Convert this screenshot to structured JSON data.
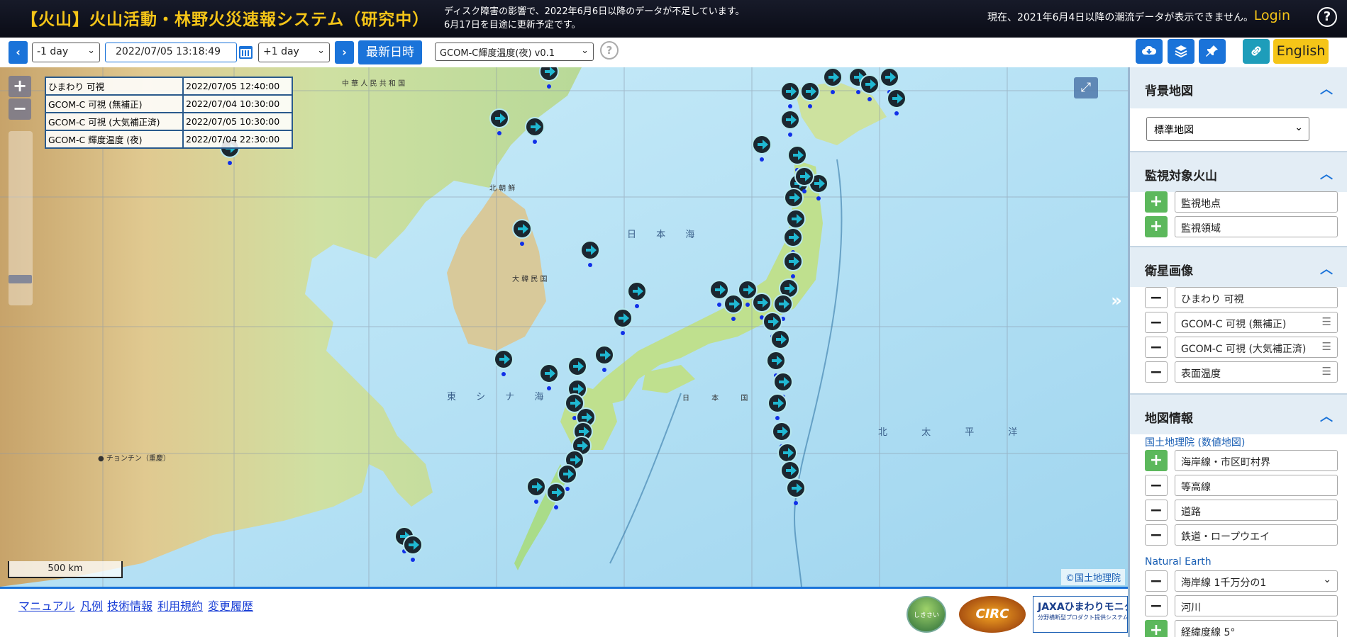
{
  "header": {
    "title": "【火山】火山活動・林野火災速報システム（研究中）",
    "notice_line1": "ディスク障害の影響で、2022年6月6日以降のデータが不足しています。",
    "notice_line2": "6月17日を目途に更新予定です。",
    "notice_right": "現在、2021年6月4日以降の潮流データが表示できません。",
    "login": "Login",
    "help": "?"
  },
  "toolbar": {
    "prev_icon": "chevron-left-icon",
    "prev_step": "-1 day",
    "datetime": "2022/07/05 13:18:49",
    "calendar_icon": "calendar-icon",
    "next_step": "+1 day",
    "next_icon": "chevron-right-icon",
    "latest": "最新日時",
    "product": "GCOM-C輝度温度(夜) v0.1",
    "product_help": "?",
    "download_icon": "cloud-download-icon",
    "layers_icon": "layers-icon",
    "pin_icon": "pin-icon",
    "link_icon": "link-icon",
    "english": "English"
  },
  "map": {
    "zoom_in": "+",
    "zoom_out": "−",
    "times": [
      {
        "label": "ひまわり 可視",
        "value": "2022/07/05 12:40:00"
      },
      {
        "label": "GCOM-C 可視 (無補正)",
        "value": "2022/07/04 10:30:00"
      },
      {
        "label": "GCOM-C 可視 (大気補正済)",
        "value": "2022/07/05 10:30:00"
      },
      {
        "label": "GCOM-C 輝度温度 (夜)",
        "value": "2022/07/04 22:30:00"
      }
    ],
    "scale": "500 km",
    "attribution": "©国土地理院",
    "expand_icon": "expand-icon",
    "labels": {
      "china": "中 華 人 民 共 和 国",
      "north_korea": "北 朝 鮮",
      "korea": "大 韓 民 国",
      "sea_japan": "日 本 海",
      "east_china_sea": "東 シ ナ 海",
      "pacific": "北 太 平 洋",
      "japan": "日 本 国",
      "cheongju": "● チョンチン（重慶）"
    }
  },
  "panel": {
    "toggle_icon": "double-chevron-right-icon",
    "basemap": {
      "title": "背景地図",
      "value": "標準地図"
    },
    "volcano": {
      "title": "監視対象火山",
      "items": [
        "監視地点",
        "監視領域"
      ]
    },
    "satellite": {
      "title": "衛星画像",
      "items": [
        "ひまわり 可視",
        "GCOM-C 可視 (無補正)",
        "GCOM-C 可視 (大気補正済)",
        "表面温度"
      ]
    },
    "mapinfo": {
      "title": "地図情報",
      "gsi_label": "国土地理院 (数値地図)",
      "gsi_items": [
        "海岸線・市区町村界",
        "等高線",
        "道路",
        "鉄道・ロープウエイ"
      ],
      "ne_label": "Natural Earth",
      "ne_items": [
        "海岸線 1千万分の1",
        "河川",
        "経緯度線 5°"
      ]
    }
  },
  "footer": {
    "links": [
      "マニュアル",
      "凡例",
      "技術情報",
      "利用規約",
      "変更履歴"
    ],
    "logo_shikisai": "しきさい",
    "logo_circ": "CIRC",
    "logo_jaxa": "JAXAひまわりモニタ",
    "logo_jaxa_sub": "分野横断型プロダクト提供システム"
  }
}
